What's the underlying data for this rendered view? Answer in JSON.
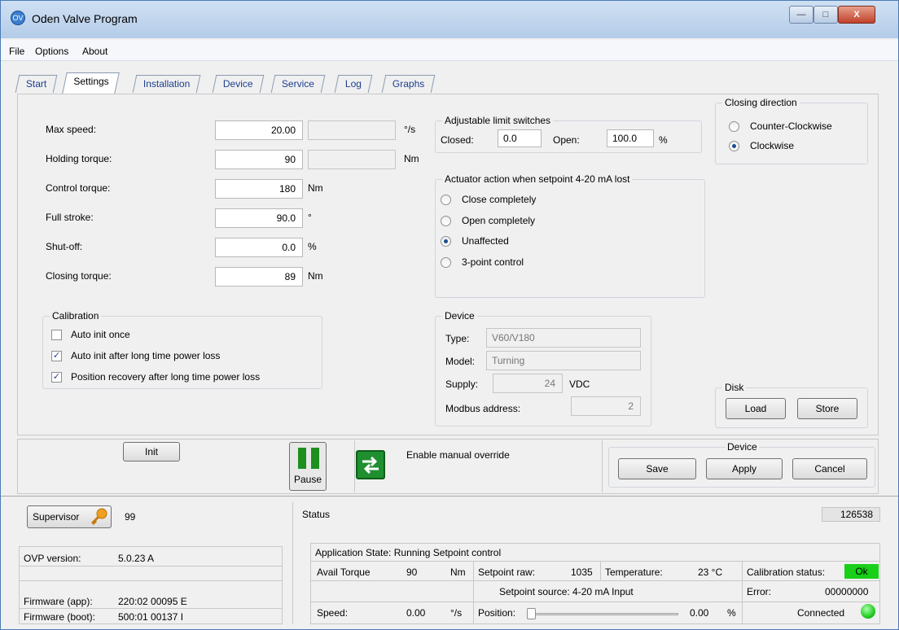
{
  "window": {
    "title": "Oden Valve Program",
    "app_icon": "gear-icon",
    "controls": {
      "minimize": "—",
      "maximize": "□",
      "close": "X"
    }
  },
  "menu": {
    "file": "File",
    "options": "Options",
    "about": "About"
  },
  "tabs": [
    "Start",
    "Settings",
    "Installation",
    "Device",
    "Service",
    "Log",
    "Graphs"
  ],
  "settings": {
    "max_speed": {
      "label": "Max speed:",
      "value": "20.00",
      "unit": "°/s"
    },
    "holding_torque": {
      "label": "Holding torque:",
      "value": "90",
      "unit": "Nm"
    },
    "control_torque": {
      "label": "Control torque:",
      "value": "180",
      "unit": "Nm"
    },
    "full_stroke": {
      "label": "Full stroke:",
      "value": "90.0",
      "unit": "°"
    },
    "shut_off": {
      "label": "Shut-off:",
      "value": "0.0",
      "unit": "%"
    },
    "closing_torque": {
      "label": "Closing torque:",
      "value": "89",
      "unit": "Nm"
    }
  },
  "calibration": {
    "title": "Calibration",
    "options": [
      {
        "label": "Auto init once",
        "checked": false
      },
      {
        "label": "Auto init after long time power loss",
        "checked": true
      },
      {
        "label": "Position recovery after long time power loss",
        "checked": true
      }
    ]
  },
  "limit_switches": {
    "title": "Adjustable limit switches",
    "closed_label": "Closed:",
    "closed_value": "0.0",
    "open_label": "Open:",
    "open_value": "100.0",
    "unit": "%"
  },
  "actuator_action": {
    "title": "Actuator action when setpoint 4-20 mA lost",
    "options": [
      "Close completely",
      "Open completely",
      "Unaffected",
      "3-point control"
    ],
    "selected": "Unaffected"
  },
  "device_info": {
    "title": "Device",
    "type_label": "Type:",
    "type_value": "V60/V180",
    "model_label": "Model:",
    "model_value": "Turning",
    "supply_label": "Supply:",
    "supply_value": "24",
    "supply_unit": "VDC",
    "modbus_label": "Modbus address:",
    "modbus_value": "2"
  },
  "closing_direction": {
    "title": "Closing direction",
    "options": [
      "Counter-Clockwise",
      "Clockwise"
    ],
    "selected": "Clockwise"
  },
  "disk": {
    "title": "Disk",
    "load": "Load",
    "store": "Store"
  },
  "actions": {
    "init": "Init",
    "pause": "Pause",
    "manual_override": "Enable manual override",
    "device_title": "Device",
    "save": "Save",
    "apply": "Apply",
    "cancel": "Cancel"
  },
  "status_bar": {
    "supervisor": "Supervisor",
    "supervisor_value": "99",
    "status_title": "Status",
    "counter": "126538",
    "ovp_label": "OVP version:",
    "ovp_value": "5.0.23 A",
    "fw_app_label": "Firmware (app):",
    "fw_app_value": "220:02 00095 E",
    "fw_boot_label": "Firmware (boot):",
    "fw_boot_value": "500:01 00137 I",
    "app_state": "Application State:  Running Setpoint control",
    "avail_torque_label": "Avail Torque",
    "avail_torque_value": "90",
    "avail_torque_unit": "Nm",
    "setpoint_raw_label": "Setpoint raw:",
    "setpoint_raw_value": "1035",
    "temperature_label": "Temperature:",
    "temperature_value": "23 °C",
    "calibration_label": "Calibration status:",
    "calibration_value": "Ok",
    "setpoint_source": "Setpoint source:  4-20 mA Input",
    "error_label": "Error:",
    "error_value": "00000000",
    "speed_label": "Speed:",
    "speed_value": "0.00",
    "speed_unit": "°/s",
    "position_label": "Position:",
    "position_value": "0.00",
    "position_unit": "%",
    "position_fraction": 0,
    "connection": "Connected",
    "ok_color": "#19d019",
    "led_color": "#22cc22"
  }
}
